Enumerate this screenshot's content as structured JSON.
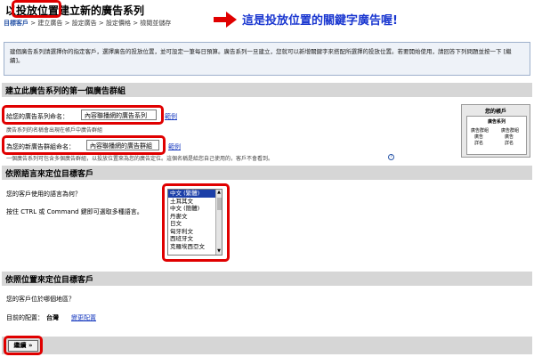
{
  "page": {
    "title": "以投放位置建立新的廣告系列",
    "steps": [
      "目標客戶",
      "建立廣告",
      "設定廣告",
      "設定價格",
      "檢閱並儲存"
    ],
    "callout_text": "這是投放位置的關鍵字廣告喔!",
    "intro": "建個廣告系列請選擇你的指定客戶，選擇廣告的投放位置，並可設定一筆每日預算。廣告系列一旦建立，您就可以新增關鍵字來搭配所選擇的投放位置。若要開始使用，請回答下列問題並按一下 [繼續]。"
  },
  "section1": {
    "header": "建立此廣告系列的第一個廣告群組",
    "campaign_label": "給您的廣告系列命名：",
    "campaign_value": "內容聯播網的廣告系列",
    "campaign_example": "範例",
    "campaign_hint": "廣告系列的名稱會出現在帳戶中廣告群組",
    "adgroup_label": "為您的新廣告群組命名：",
    "adgroup_value": "內容聯播網的廣告群組",
    "adgroup_example": "範例",
    "adgroup_hint": "一個廣告系列可包含多個廣告群組，以投放位置來為您的廣告定位。這個名稱是給您自己使用的，客戶不會看到。",
    "preview": {
      "title": "您的帳戶",
      "subtitle": "廣告系列",
      "col1": [
        "廣告群組",
        "廣告",
        "詳名"
      ],
      "col2": [
        "廣告群組",
        "廣告",
        "詳名"
      ]
    }
  },
  "section2": {
    "header": "依照語言來定位目標客戶",
    "question": "您的客戶使用的語言為何？",
    "hint": "按住 CTRL 或 Command 鍵即可選取多種語言。",
    "languages": [
      "中文 (繁體)",
      "土耳其文",
      "中文 (簡體)",
      "丹麥文",
      "日文",
      "匈牙利文",
      "西班牙文",
      "克羅埃西亞文"
    ],
    "selected": "中文 (繁體)"
  },
  "section3": {
    "header": "依照位置來定位目標客戶",
    "question": "您的客戶位於哪個地區？",
    "current_label": "目前的配置：",
    "current_value": "台灣",
    "change_link": "變更配置"
  },
  "continue_label": "繼續 »",
  "colors": {
    "highlight": "#e00000",
    "callout": "#1a37d0",
    "section_bg": "#d6d6d6"
  }
}
